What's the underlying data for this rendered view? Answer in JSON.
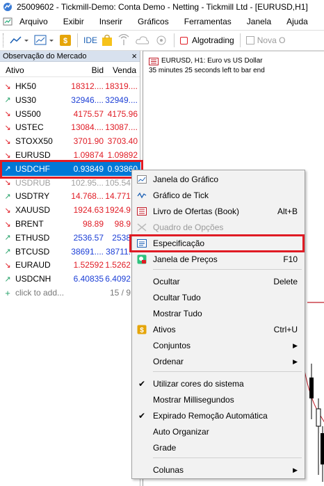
{
  "window": {
    "title": "25009602 - Tickmill-Demo: Conta Demo - Netting - Tickmill Ltd - [EURUSD,H1]"
  },
  "menu": [
    "Arquivo",
    "Exibir",
    "Inserir",
    "Gráficos",
    "Ferramentas",
    "Janela",
    "Ajuda"
  ],
  "toolbar": {
    "ide": "IDE",
    "algotrading": "Algotrading",
    "nova_ordem": "Nova O"
  },
  "market_watch": {
    "title": "Observação do Mercado",
    "close": "×",
    "columns": {
      "ativo": "Ativo",
      "bid": "Bid",
      "venda": "Venda"
    },
    "rows": [
      {
        "symbol": "HK50",
        "bid": "18312....",
        "ask": "18319....",
        "dir": "down",
        "color": "red"
      },
      {
        "symbol": "US30",
        "bid": "32946....",
        "ask": "32949....",
        "dir": "up",
        "color": "blue"
      },
      {
        "symbol": "US500",
        "bid": "4175.57",
        "ask": "4175.96",
        "dir": "down",
        "color": "red"
      },
      {
        "symbol": "USTEC",
        "bid": "13084....",
        "ask": "13087....",
        "dir": "down",
        "color": "red"
      },
      {
        "symbol": "STOXX50",
        "bid": "3701.90",
        "ask": "3703.40",
        "dir": "down",
        "color": "red"
      },
      {
        "symbol": "EURUSD",
        "bid": "1.09874",
        "ask": "1.09892",
        "dir": "down",
        "color": "red"
      },
      {
        "symbol": "USDCHF",
        "bid": "0.93849",
        "ask": "0.93860",
        "dir": "up",
        "color": "sel"
      },
      {
        "symbol": "USDRUB",
        "bid": "102.95...",
        "ask": "105.54...",
        "dir": "down",
        "color": "grey"
      },
      {
        "symbol": "USDTRY",
        "bid": "14.768...",
        "ask": "14.771...",
        "dir": "up",
        "color": "red"
      },
      {
        "symbol": "XAUUSD",
        "bid": "1924.63",
        "ask": "1924.9...",
        "dir": "down",
        "color": "red"
      },
      {
        "symbol": "BRENT",
        "bid": "98.89",
        "ask": "98.9...",
        "dir": "down",
        "color": "red"
      },
      {
        "symbol": "ETHUSD",
        "bid": "2536.57",
        "ask": "2538...",
        "dir": "up",
        "color": "blue"
      },
      {
        "symbol": "BTCUSD",
        "bid": "38691....",
        "ask": "38711....",
        "dir": "up",
        "color": "blue"
      },
      {
        "symbol": "EURAUD",
        "bid": "1.52592",
        "ask": "1.5262...",
        "dir": "down",
        "color": "red"
      },
      {
        "symbol": "USDCNH",
        "bid": "6.40835",
        "ask": "6.4092...",
        "dir": "up",
        "color": "blue"
      }
    ],
    "add_row": {
      "label": "click to add...",
      "count": "15 / 9..."
    }
  },
  "chart": {
    "title": "EURUSD, H1:  Euro vs US Dollar",
    "timer": "35 minutes 25 seconds left to bar end"
  },
  "context_menu": [
    {
      "label": "Janela do Gráfico",
      "icon": "chart-window-icon",
      "shortcut": "",
      "arrow": false,
      "disabled": false
    },
    {
      "label": "Gráfico de Tick",
      "icon": "tick-chart-icon",
      "shortcut": "",
      "arrow": false,
      "disabled": false
    },
    {
      "label": "Livro de Ofertas (Book)",
      "icon": "order-book-icon",
      "shortcut": "Alt+B",
      "arrow": false,
      "disabled": false
    },
    {
      "label": "Quadro de Opções",
      "icon": "options-board-icon",
      "shortcut": "",
      "arrow": false,
      "disabled": true
    },
    {
      "label": "Especificação",
      "icon": "specification-icon",
      "shortcut": "",
      "arrow": false,
      "disabled": false
    },
    {
      "label": "Janela de Preços",
      "icon": "price-window-icon",
      "shortcut": "F10",
      "arrow": false,
      "disabled": false
    },
    {
      "sep": true
    },
    {
      "label": "Ocultar",
      "icon": "",
      "shortcut": "Delete",
      "arrow": false,
      "disabled": false
    },
    {
      "label": "Ocultar Tudo",
      "icon": "",
      "shortcut": "",
      "arrow": false,
      "disabled": false
    },
    {
      "label": "Mostrar Tudo",
      "icon": "",
      "shortcut": "",
      "arrow": false,
      "disabled": false
    },
    {
      "label": "Ativos",
      "icon": "dollar-icon",
      "shortcut": "Ctrl+U",
      "arrow": false,
      "disabled": false
    },
    {
      "label": "Conjuntos",
      "icon": "",
      "shortcut": "",
      "arrow": true,
      "disabled": false
    },
    {
      "label": "Ordenar",
      "icon": "",
      "shortcut": "",
      "arrow": true,
      "disabled": false
    },
    {
      "sep": true
    },
    {
      "label": "Utilizar cores do sistema",
      "icon": "check-icon",
      "shortcut": "",
      "arrow": false,
      "disabled": false
    },
    {
      "label": "Mostrar Millisegundos",
      "icon": "",
      "shortcut": "",
      "arrow": false,
      "disabled": false
    },
    {
      "label": "Expirado Remoção Automática",
      "icon": "check-icon",
      "shortcut": "",
      "arrow": false,
      "disabled": false
    },
    {
      "label": "Auto Organizar",
      "icon": "",
      "shortcut": "",
      "arrow": false,
      "disabled": false
    },
    {
      "label": "Grade",
      "icon": "",
      "shortcut": "",
      "arrow": false,
      "disabled": false
    },
    {
      "sep": true
    },
    {
      "label": "Colunas",
      "icon": "",
      "shortcut": "",
      "arrow": true,
      "disabled": false
    }
  ],
  "colors": {
    "highlight": "#e01b24",
    "selection": "#0078d7"
  }
}
